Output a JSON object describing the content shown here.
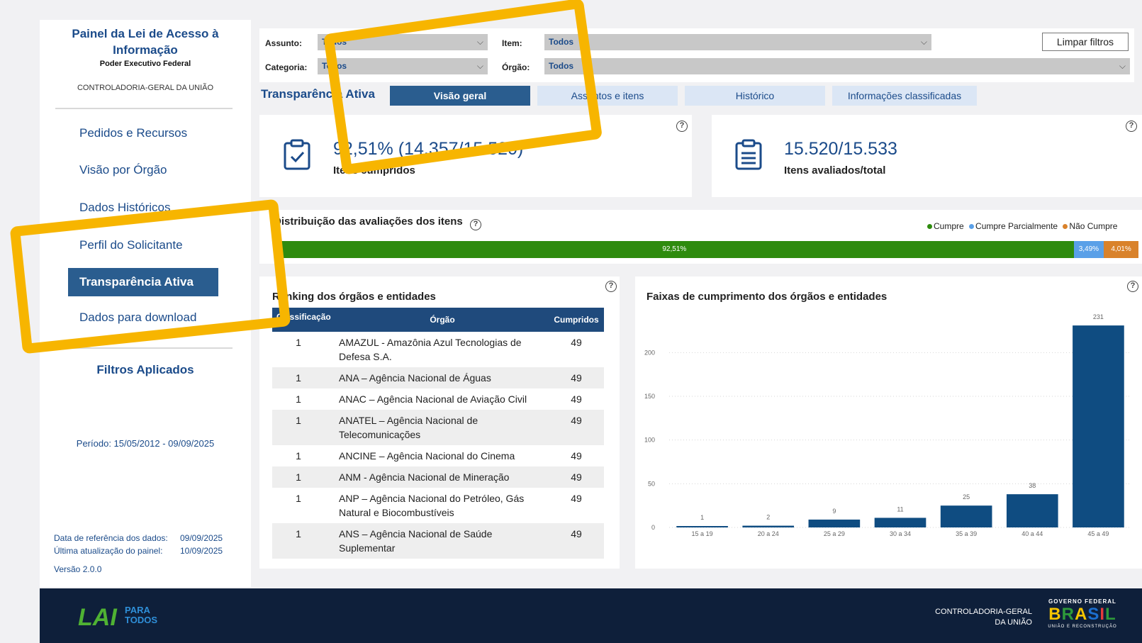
{
  "sidebar": {
    "title_line1": "Painel da Lei de Acesso à",
    "title_line2": "Informação",
    "subtitle": "Poder Executivo Federal",
    "org": "CONTROLADORIA-GERAL DA UNIÃO",
    "nav": [
      {
        "label": "Pedidos e Recursos"
      },
      {
        "label": "Visão por Órgão"
      },
      {
        "label": "Dados Históricos"
      },
      {
        "label": "Perfil do Solicitante"
      },
      {
        "label": "Transparência Ativa"
      },
      {
        "label": "Dados para download"
      }
    ],
    "filtros": "Filtros Aplicados",
    "periodo": "Período: 15/05/2012 - 09/09/2025",
    "ref_label": "Data de referência dos dados:",
    "ref_value": "09/09/2025",
    "update_label": "Última atualização do painel:",
    "update_value": "10/09/2025",
    "version": "Versão 2.0.0"
  },
  "filters": {
    "assunto_label": "Assunto:",
    "assunto_value": "Todos",
    "item_label": "Item:",
    "item_value": "Todos",
    "categoria_label": "Categoria:",
    "categoria_value": "Todos",
    "orgao_label": "Órgão:",
    "orgao_value": "Todos",
    "clear": "Limpar filtros"
  },
  "section_title": "Transparência Ativa",
  "tabs": [
    {
      "label": "Visão geral",
      "active": true
    },
    {
      "label": "Assuntos e itens",
      "active": false
    },
    {
      "label": "Histórico",
      "active": false
    },
    {
      "label": "Informações classificadas",
      "active": false
    }
  ],
  "kpis": {
    "cumpridos_value": "92,51% (14.357/15.520)",
    "cumpridos_label": "Itens cumpridos",
    "avaliados_value": "15.520/15.533",
    "avaliados_label": "Itens avaliados/total"
  },
  "distribution": {
    "title": "Distribuição das avaliações dos itens",
    "legend": [
      "Cumpre",
      "Cumpre Parcialmente",
      "Não Cumpre"
    ],
    "colors": [
      "#2e8b0e",
      "#5aa0e8",
      "#d9822b"
    ],
    "values": [
      92.51,
      3.49,
      4.01
    ],
    "labels": [
      "92,51%",
      "3,49%",
      "4,01%"
    ]
  },
  "ranking": {
    "title": "Ranking dos órgãos e entidades",
    "headers": [
      "Classificação",
      "Órgão",
      "Cumpridos"
    ],
    "rows": [
      {
        "rank": "1",
        "org": "AMAZUL - Amazônia Azul Tecnologias de Defesa S.A.",
        "count": "49"
      },
      {
        "rank": "1",
        "org": "ANA – Agência Nacional de Águas",
        "count": "49"
      },
      {
        "rank": "1",
        "org": "ANAC – Agência Nacional de Aviação Civil",
        "count": "49"
      },
      {
        "rank": "1",
        "org": "ANATEL – Agência Nacional de Telecomunicações",
        "count": "49"
      },
      {
        "rank": "1",
        "org": "ANCINE – Agência Nacional do Cinema",
        "count": "49"
      },
      {
        "rank": "1",
        "org": "ANM - Agência Nacional de Mineração",
        "count": "49"
      },
      {
        "rank": "1",
        "org": "ANP – Agência Nacional do Petróleo, Gás Natural e Biocombustíveis",
        "count": "49"
      },
      {
        "rank": "1",
        "org": "ANS – Agência Nacional de Saúde Suplementar",
        "count": "49"
      }
    ]
  },
  "chart_data": {
    "type": "bar",
    "title": "Faixas de cumprimento dos órgãos e entidades",
    "categories": [
      "15 a 19",
      "20 a 24",
      "25 a 29",
      "30 a 34",
      "35 a 39",
      "40 a 44",
      "45 a 49"
    ],
    "values": [
      1,
      2,
      9,
      11,
      25,
      38,
      231
    ],
    "yticks": [
      0,
      50,
      100,
      150,
      200
    ],
    "ylim": [
      0,
      240
    ],
    "color": "#0f4c81",
    "grid": true
  },
  "footer": {
    "logo_text1": "LAI",
    "logo_text2": "PARA",
    "logo_text3": "TODOS",
    "cgu_line1": "CONTROLADORIA-GERAL",
    "cgu_line2": "DA UNIÃO",
    "gov_line1": "GOVERNO FEDERAL",
    "gov_brasil": "BRASIL",
    "gov_line2": "UNIÃO E RECONSTRUÇÃO"
  }
}
